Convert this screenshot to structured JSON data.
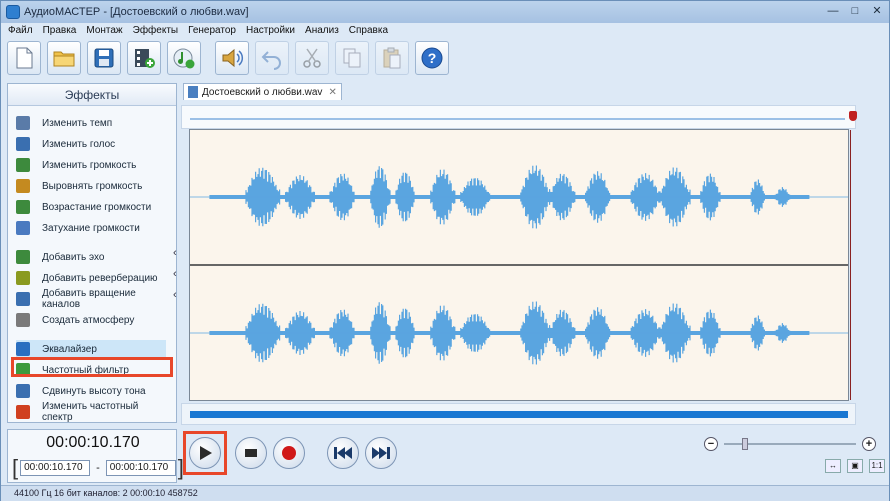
{
  "window": {
    "title": "АудиоМАСТЕР - [Достоевский о любви.wav]",
    "controls": [
      "minimize",
      "maximize",
      "close"
    ]
  },
  "menu": [
    "Файл",
    "Правка",
    "Монтаж",
    "Эффекты",
    "Генератор",
    "Настройки",
    "Анализ",
    "Справка"
  ],
  "toolbar": {
    "icons": [
      "new-file-icon",
      "open-folder-icon",
      "save-icon",
      "add-video-icon",
      "add-music-icon",
      "speaker-icon",
      "undo-icon",
      "cut-icon",
      "copy-icon",
      "paste-icon",
      "help-icon"
    ]
  },
  "effects": {
    "header": "Эффекты",
    "items": [
      {
        "label": "Изменить темп",
        "icon": "clock-icon",
        "color": "#5a7ba8"
      },
      {
        "label": "Изменить голос",
        "icon": "person-icon",
        "color": "#3a6fb0"
      },
      {
        "label": "Изменить громкость",
        "icon": "volume-icon",
        "color": "#3d8a3d"
      },
      {
        "label": "Выровнять громкость",
        "icon": "level-icon",
        "color": "#c48a20"
      },
      {
        "label": "Возрастание громкости",
        "icon": "fade-in-icon",
        "color": "#3d8a3d"
      },
      {
        "label": "Затухание громкости",
        "icon": "fade-out-icon",
        "color": "#4a7ac0"
      },
      {
        "label": "Добавить эхо",
        "icon": "echo-icon",
        "color": "#3d8a3d"
      },
      {
        "label": "Добавить реверберацию",
        "icon": "reverb-icon",
        "color": "#8a9a20"
      },
      {
        "label": "Добавить вращение каналов",
        "icon": "rotate-icon",
        "color": "#3a6fb0"
      },
      {
        "label": "Создать атмосферу",
        "icon": "atmosphere-icon",
        "color": "#7a7a7a"
      },
      {
        "label": "Эквалайзер",
        "icon": "equalizer-icon",
        "color": "#2a6fc0"
      },
      {
        "label": "Частотный фильтр",
        "icon": "filter-icon",
        "color": "#3d9a3d"
      },
      {
        "label": "Сдвинуть высоту тона",
        "icon": "pitch-icon",
        "color": "#3a6fb0"
      },
      {
        "label": "Изменить частотный спектр",
        "icon": "spectrum-icon",
        "color": "#d04020"
      }
    ],
    "selected": "Эквалайзер"
  },
  "document_tab": {
    "label": "Достоевский о любви.wav"
  },
  "player": {
    "current_time": "00:00:10.170",
    "range_start": "00:00:10.170",
    "range_end": "00:00:10.170",
    "range_sep": "-",
    "bracket_open": "[",
    "bracket_close": "]"
  },
  "zoom": {
    "minus": "−",
    "plus": "+"
  },
  "status": {
    "text": "44100 Гц  16 бит  каналов: 2  00:00:10 458752"
  },
  "colors": {
    "waveform": "#5aa5e0",
    "highlight": "#e8472a",
    "playhead": "#8a2020",
    "wave_bg": "#fbf5ec"
  }
}
